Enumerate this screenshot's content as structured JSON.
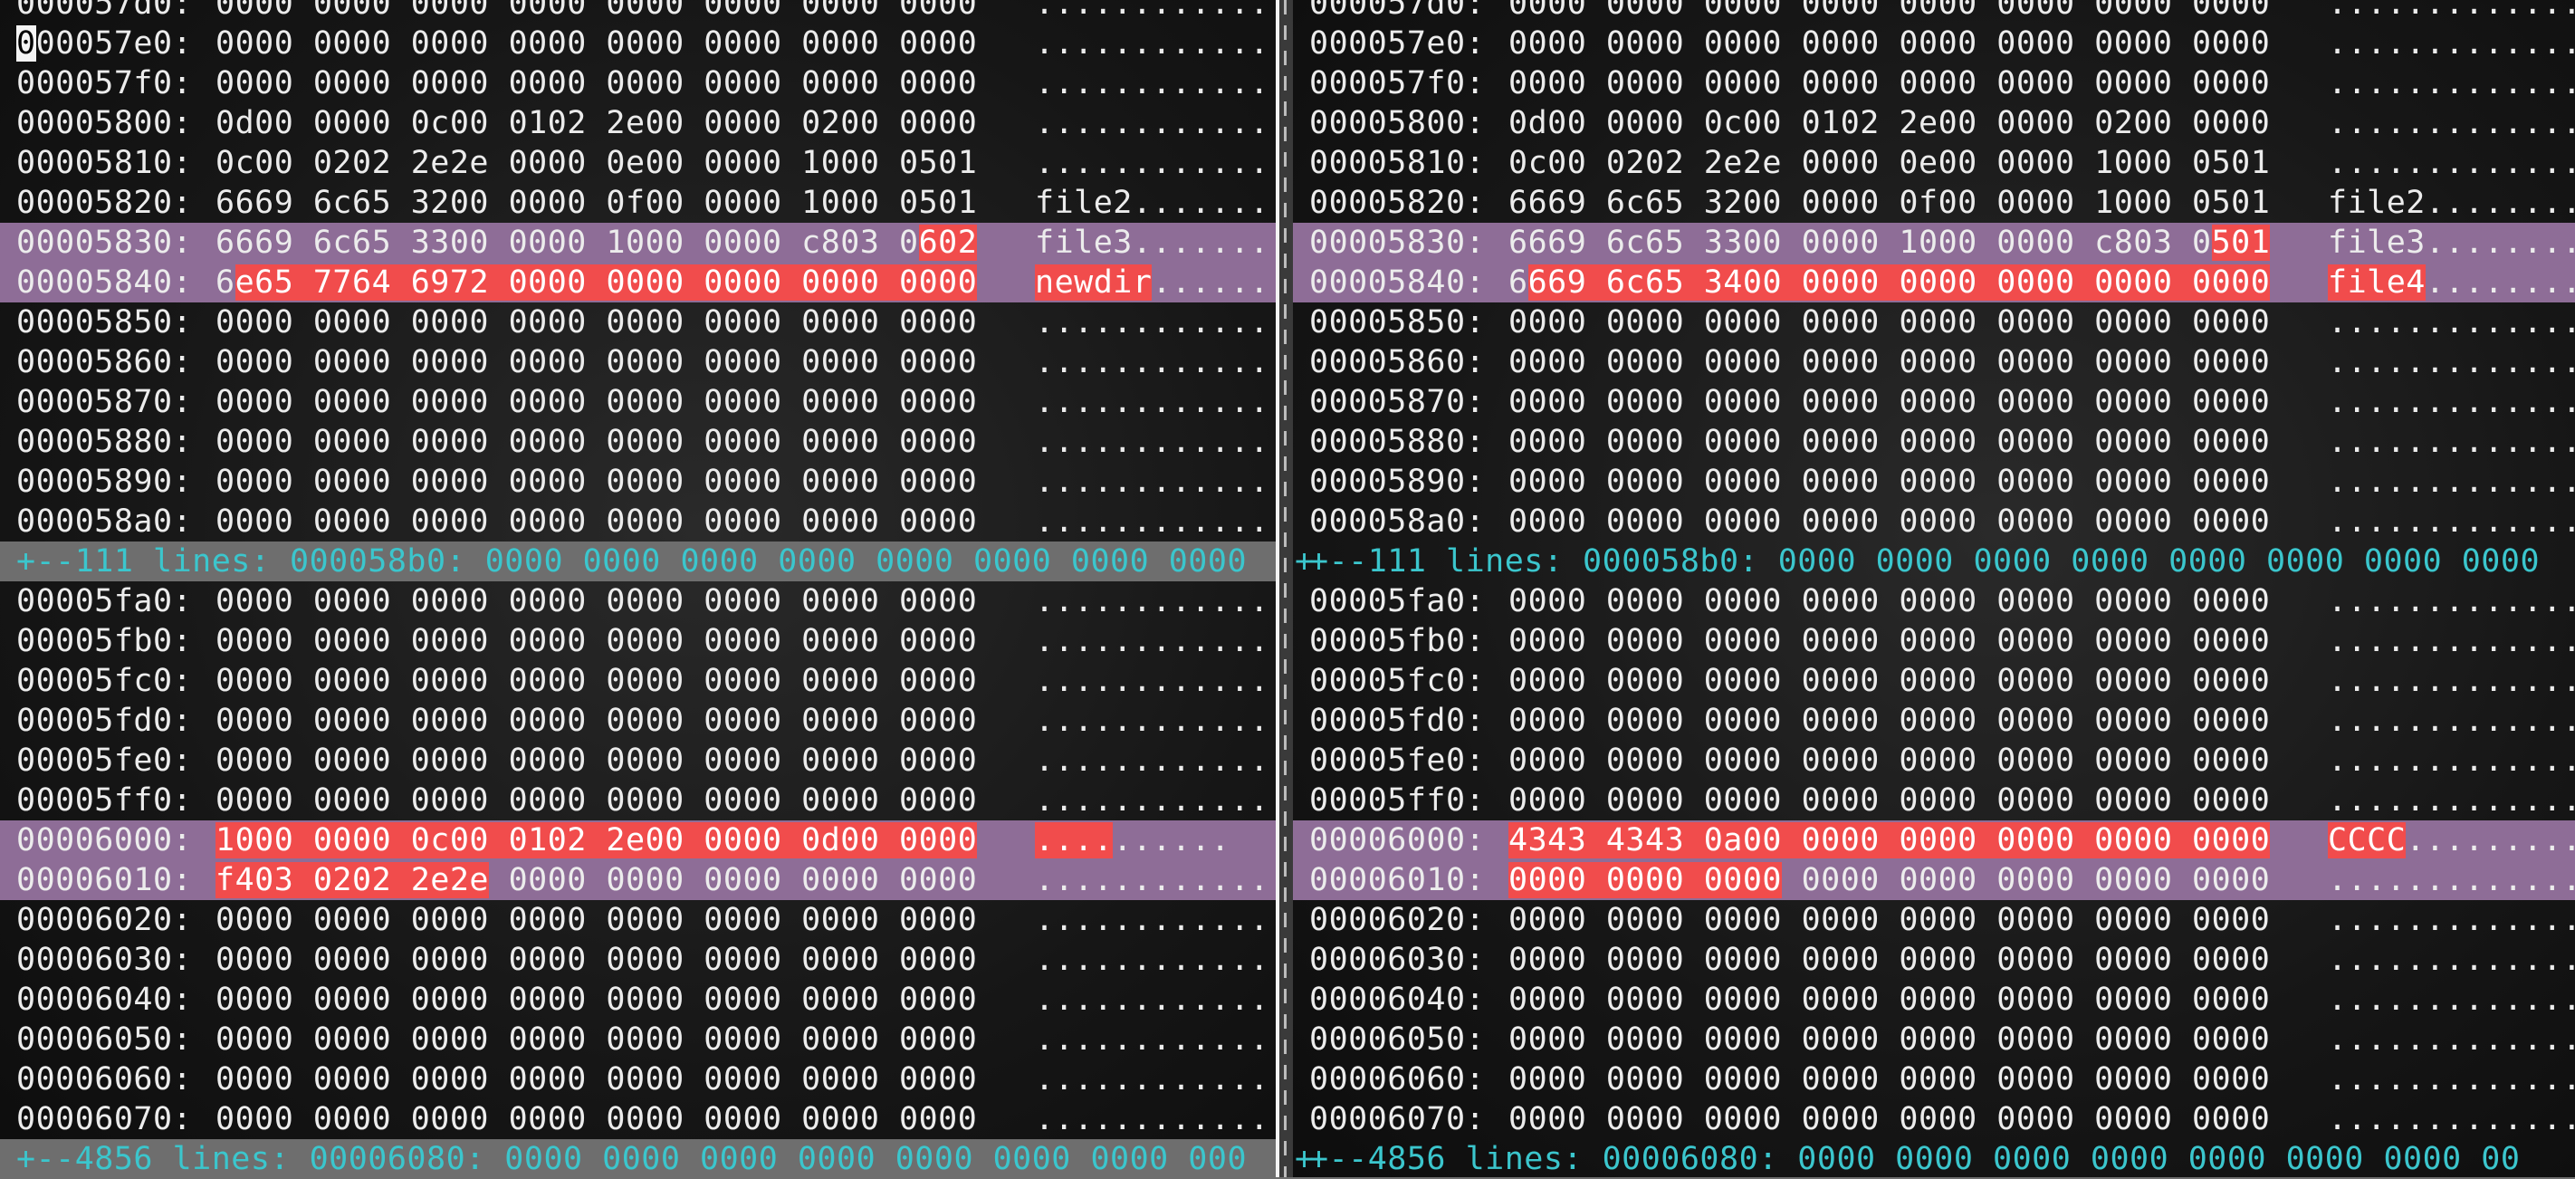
{
  "left_pane": {
    "rows": [
      {
        "addr": "000057d0:",
        "hex": "0000 0000 0000 0000 0000 0000 0000 0000",
        "asc": "................"
      },
      {
        "addr": "000057e0:",
        "hex": "0000 0000 0000 0000 0000 0000 0000 0000",
        "asc": "................"
      },
      {
        "addr": "000057f0:",
        "hex": "0000 0000 0000 0000 0000 0000 0000 0000",
        "asc": "................"
      },
      {
        "addr": "00005800:",
        "hex": "0d00 0000 0c00 0102 2e00 0000 0200 0000",
        "asc": "................"
      },
      {
        "addr": "00005810:",
        "hex": "0c00 0202 2e2e 0000 0e00 0000 1000 0501",
        "asc": "................"
      },
      {
        "addr": "00005820:",
        "hex": "6669 6c65 3200 0000 0f00 0000 1000 0501",
        "asc": "file2..........."
      },
      {
        "addr": "00005830:",
        "hex_a": "6669 6c65 3300 0000 1000 0000 c803 0",
        "hex_b": "602",
        "asc": "file3..........."
      },
      {
        "addr": "00005840:",
        "hex_a": "6",
        "hex_b": "e65 7764 6972 0000 0000 0000 0000 0000",
        "asc_b": "newdir",
        "asc_c": "......"
      },
      {
        "addr": "00005850:",
        "hex": "0000 0000 0000 0000 0000 0000 0000 0000",
        "asc": "................"
      },
      {
        "addr": "00005860:",
        "hex": "0000 0000 0000 0000 0000 0000 0000 0000",
        "asc": "................"
      },
      {
        "addr": "00005870:",
        "hex": "0000 0000 0000 0000 0000 0000 0000 0000",
        "asc": "................"
      },
      {
        "addr": "00005880:",
        "hex": "0000 0000 0000 0000 0000 0000 0000 0000",
        "asc": "................"
      },
      {
        "addr": "00005890:",
        "hex": "0000 0000 0000 0000 0000 0000 0000 0000",
        "asc": "................"
      },
      {
        "addr": "000058a0:",
        "hex": "0000 0000 0000 0000 0000 0000 0000 0000",
        "asc": "................"
      }
    ],
    "fold1": "+--111 lines: 000058b0: 0000 0000 0000 0000 0000 0000 0000 0000",
    "rows2": [
      {
        "addr": "00005fa0:",
        "hex": "0000 0000 0000 0000 0000 0000 0000 0000",
        "asc": "................"
      },
      {
        "addr": "00005fb0:",
        "hex": "0000 0000 0000 0000 0000 0000 0000 0000",
        "asc": "................"
      },
      {
        "addr": "00005fc0:",
        "hex": "0000 0000 0000 0000 0000 0000 0000 0000",
        "asc": "................"
      },
      {
        "addr": "00005fd0:",
        "hex": "0000 0000 0000 0000 0000 0000 0000 0000",
        "asc": "................"
      },
      {
        "addr": "00005fe0:",
        "hex": "0000 0000 0000 0000 0000 0000 0000 0000",
        "asc": "................"
      },
      {
        "addr": "00005ff0:",
        "hex": "0000 0000 0000 0000 0000 0000 0000 0000",
        "asc": "................"
      },
      {
        "addr": "00006000:",
        "hex_b": "1000 0000 0c00 0102 2e00 0000 0d00 0000",
        "asc_b": "....",
        "asc_c": "......"
      },
      {
        "addr": "00006010:",
        "hex_b": "f403 0202 2e2e",
        "hex_c": " 0000 0000 0000 0000 0000",
        "asc": "................"
      },
      {
        "addr": "00006020:",
        "hex": "0000 0000 0000 0000 0000 0000 0000 0000",
        "asc": "................"
      },
      {
        "addr": "00006030:",
        "hex": "0000 0000 0000 0000 0000 0000 0000 0000",
        "asc": "................"
      },
      {
        "addr": "00006040:",
        "hex": "0000 0000 0000 0000 0000 0000 0000 0000",
        "asc": "................"
      },
      {
        "addr": "00006050:",
        "hex": "0000 0000 0000 0000 0000 0000 0000 0000",
        "asc": "................"
      },
      {
        "addr": "00006060:",
        "hex": "0000 0000 0000 0000 0000 0000 0000 0000",
        "asc": "................"
      },
      {
        "addr": "00006070:",
        "hex": "0000 0000 0000 0000 0000 0000 0000 0000",
        "asc": "................"
      }
    ],
    "fold2": "+--4856 lines: 00006080: 0000 0000 0000 0000 0000 0000 0000 000"
  },
  "right_pane": {
    "rows": [
      {
        "addr": "000057d0:",
        "hex": "0000 0000 0000 0000 0000 0000 0000 0000",
        "asc": "................"
      },
      {
        "addr": "000057e0:",
        "hex": "0000 0000 0000 0000 0000 0000 0000 0000",
        "asc": "................"
      },
      {
        "addr": "000057f0:",
        "hex": "0000 0000 0000 0000 0000 0000 0000 0000",
        "asc": "................"
      },
      {
        "addr": "00005800:",
        "hex": "0d00 0000 0c00 0102 2e00 0000 0200 0000",
        "asc": "................"
      },
      {
        "addr": "00005810:",
        "hex": "0c00 0202 2e2e 0000 0e00 0000 1000 0501",
        "asc": "................"
      },
      {
        "addr": "00005820:",
        "hex": "6669 6c65 3200 0000 0f00 0000 1000 0501",
        "asc": "file2..........."
      },
      {
        "addr": "00005830:",
        "hex_a": "6669 6c65 3300 0000 1000 0000 c803 0",
        "hex_b": "501",
        "asc": "file3..........."
      },
      {
        "addr": "00005840:",
        "hex_a": "6",
        "hex_b": "669 6c65 3400 0000 0000 0000 0000 0000",
        "asc_b": "file4",
        "asc_c": "..........."
      },
      {
        "addr": "00005850:",
        "hex": "0000 0000 0000 0000 0000 0000 0000 0000",
        "asc": "................"
      },
      {
        "addr": "00005860:",
        "hex": "0000 0000 0000 0000 0000 0000 0000 0000",
        "asc": "................"
      },
      {
        "addr": "00005870:",
        "hex": "0000 0000 0000 0000 0000 0000 0000 0000",
        "asc": "................"
      },
      {
        "addr": "00005880:",
        "hex": "0000 0000 0000 0000 0000 0000 0000 0000",
        "asc": "................"
      },
      {
        "addr": "00005890:",
        "hex": "0000 0000 0000 0000 0000 0000 0000 0000",
        "asc": "................"
      },
      {
        "addr": "000058a0:",
        "hex": "0000 0000 0000 0000 0000 0000 0000 0000",
        "asc": "................"
      }
    ],
    "fold1": "+--111 lines: 000058b0: 0000 0000 0000 0000 0000 0000 0000 0000",
    "rows2": [
      {
        "addr": "00005fa0:",
        "hex": "0000 0000 0000 0000 0000 0000 0000 0000",
        "asc": "................"
      },
      {
        "addr": "00005fb0:",
        "hex": "0000 0000 0000 0000 0000 0000 0000 0000",
        "asc": "................"
      },
      {
        "addr": "00005fc0:",
        "hex": "0000 0000 0000 0000 0000 0000 0000 0000",
        "asc": "................"
      },
      {
        "addr": "00005fd0:",
        "hex": "0000 0000 0000 0000 0000 0000 0000 0000",
        "asc": "................"
      },
      {
        "addr": "00005fe0:",
        "hex": "0000 0000 0000 0000 0000 0000 0000 0000",
        "asc": "................"
      },
      {
        "addr": "00005ff0:",
        "hex": "0000 0000 0000 0000 0000 0000 0000 0000",
        "asc": "................"
      },
      {
        "addr": "00006000:",
        "hex_b": "4343 4343 0a00 0000 0000 0000 0000 0000",
        "asc_b": "CCCC",
        "asc_c": "............"
      },
      {
        "addr": "00006010:",
        "hex_b": "0000 0000 0000",
        "hex_c": " 0000 0000 0000 0000 0000",
        "asc": "................"
      },
      {
        "addr": "00006020:",
        "hex": "0000 0000 0000 0000 0000 0000 0000 0000",
        "asc": "................"
      },
      {
        "addr": "00006030:",
        "hex": "0000 0000 0000 0000 0000 0000 0000 0000",
        "asc": "................"
      },
      {
        "addr": "00006040:",
        "hex": "0000 0000 0000 0000 0000 0000 0000 0000",
        "asc": "................"
      },
      {
        "addr": "00006050:",
        "hex": "0000 0000 0000 0000 0000 0000 0000 0000",
        "asc": "................"
      },
      {
        "addr": "00006060:",
        "hex": "0000 0000 0000 0000 0000 0000 0000 0000",
        "asc": "................"
      },
      {
        "addr": "00006070:",
        "hex": "0000 0000 0000 0000 0000 0000 0000 0000",
        "asc": "................"
      }
    ],
    "fold1_plus": "+",
    "fold2": "+--4856 lines: 00006080: 0000 0000 0000 0000 0000 0000 0000 00",
    "fold2_plus": "+"
  },
  "colors": {
    "changed_line": "#8e6d97",
    "diff_text": "#f14c4c",
    "fold_text": "#3bc6cd"
  }
}
